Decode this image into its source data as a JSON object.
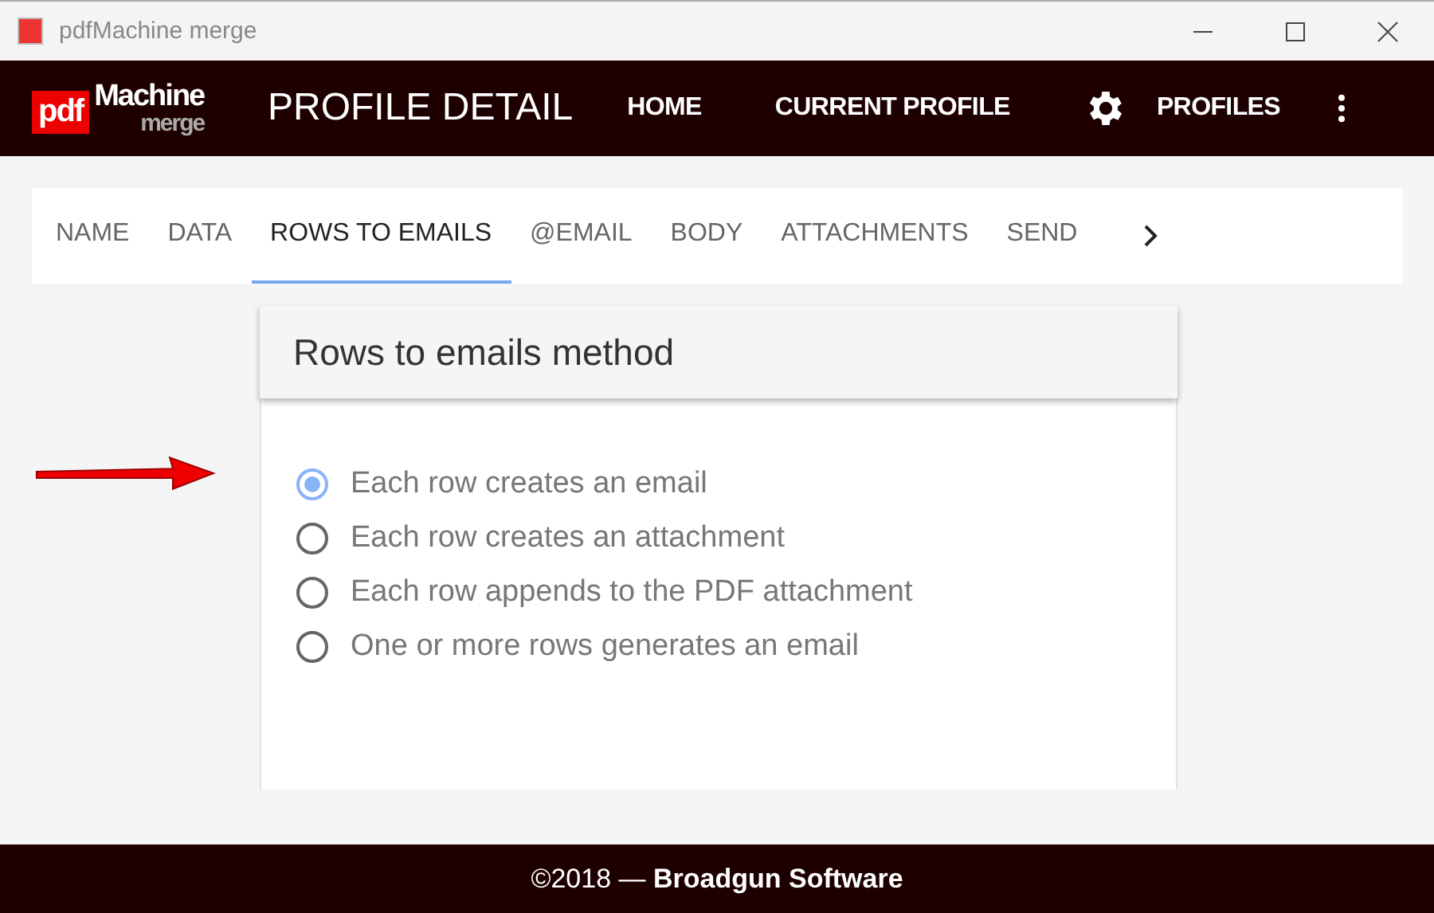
{
  "window": {
    "title": "pdfMachine merge"
  },
  "logo": {
    "main": "pdf",
    "name": "Machine",
    "sub": "merge"
  },
  "header": {
    "title": "PROFILE DETAIL",
    "nav": [
      {
        "label": "HOME",
        "kind": "plain"
      },
      {
        "label": "CURRENT PROFILE",
        "kind": "plain"
      },
      {
        "label": "PROFILES",
        "kind": "settings"
      }
    ]
  },
  "tabs": [
    {
      "label": "NAME",
      "selected": false
    },
    {
      "label": "DATA",
      "selected": false
    },
    {
      "label": "ROWS TO EMAILS",
      "selected": true
    },
    {
      "label": "@EMAIL",
      "selected": false
    },
    {
      "label": "BODY",
      "selected": false
    },
    {
      "label": "ATTACHMENTS",
      "selected": false
    },
    {
      "label": "SEND",
      "selected": false
    }
  ],
  "card": {
    "title": "Rows to emails method",
    "options": [
      {
        "label": "Each row creates an email",
        "selected": true
      },
      {
        "label": "Each row creates an attachment",
        "selected": false
      },
      {
        "label": "Each row appends to the PDF attachment",
        "selected": false
      },
      {
        "label": "One or more rows generates an email",
        "selected": false
      }
    ]
  },
  "footer": "©2018 — **Broadgun Software**"
}
